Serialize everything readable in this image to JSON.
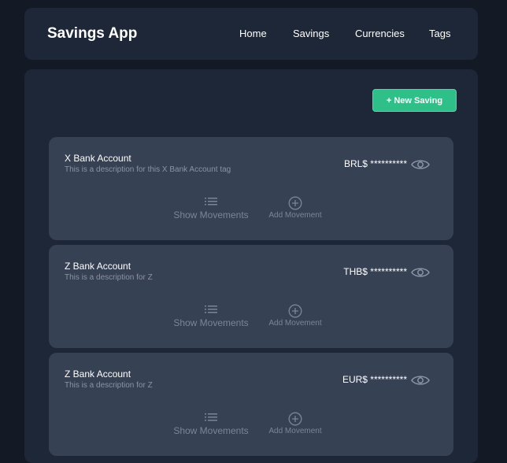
{
  "header": {
    "app_title": "Savings App",
    "nav": [
      "Home",
      "Savings",
      "Currencies",
      "Tags"
    ]
  },
  "main": {
    "new_saving_label": "+ New Saving",
    "cards": [
      {
        "title": "X Bank Account",
        "description": "This is a description for this X Bank Account tag",
        "balance": "BRL$ **********",
        "show_label": "Show Movements",
        "add_label": "Add Movement"
      },
      {
        "title": "Z Bank Account",
        "description": "This is a description for Z",
        "balance": "THB$ **********",
        "show_label": "Show Movements",
        "add_label": "Add Movement"
      },
      {
        "title": "Z Bank Account",
        "description": "This is a description for Z",
        "balance": "EUR$ **********",
        "show_label": "Show Movements",
        "add_label": "Add Movement"
      }
    ]
  },
  "icons": {
    "eye": "eye-icon",
    "list": "list-icon",
    "add": "plus-circle-icon"
  },
  "colors": {
    "background": "#141a25",
    "panel": "#1e2737",
    "card": "#374154",
    "accent": "#2fbf88"
  }
}
